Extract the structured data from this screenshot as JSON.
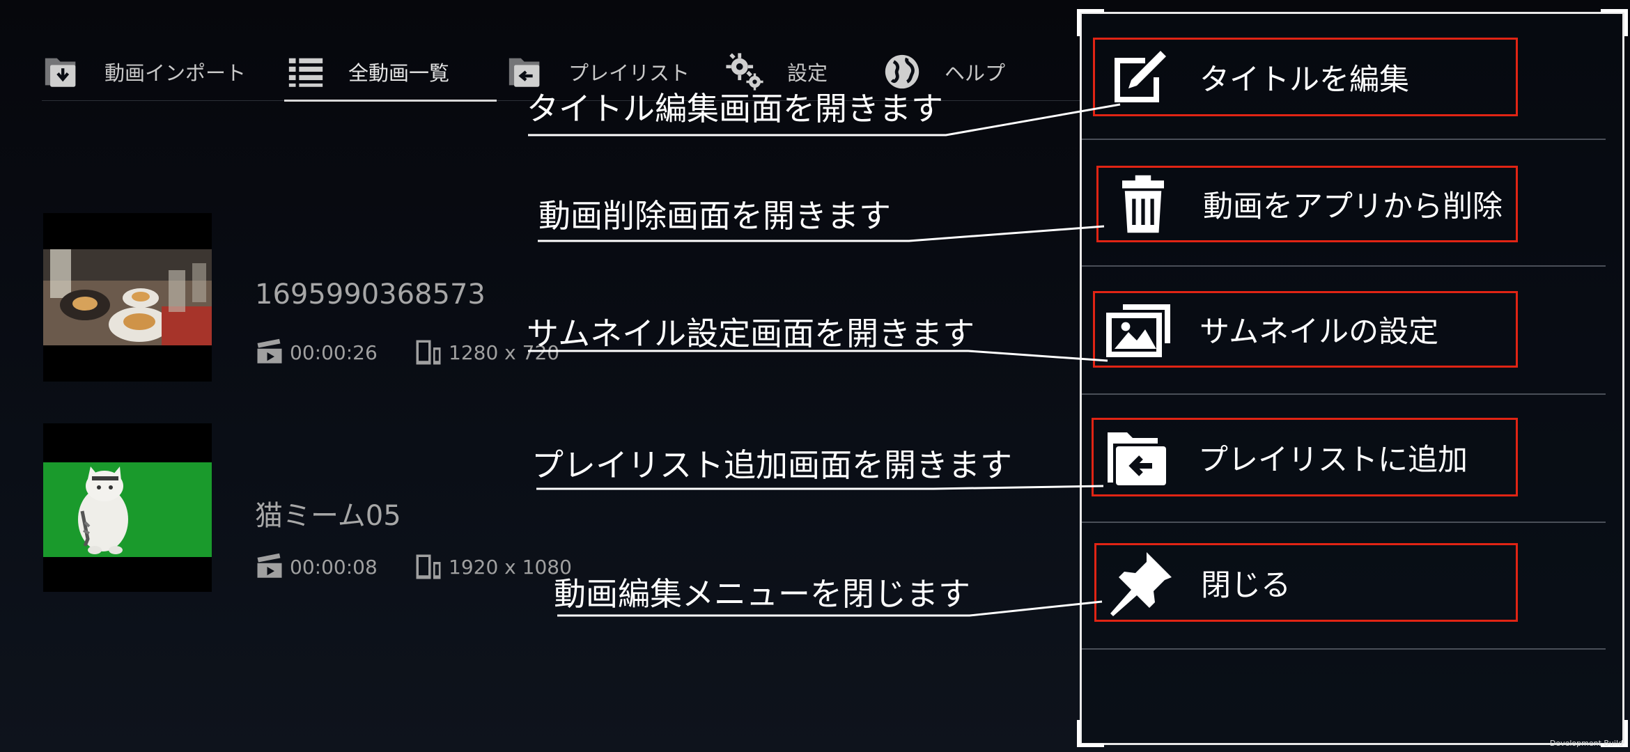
{
  "nav": {
    "items": [
      {
        "label": "動画インポート",
        "icon": "import-icon"
      },
      {
        "label": "全動画一覧",
        "icon": "list-icon"
      },
      {
        "label": "プレイリスト",
        "icon": "playlist-icon"
      },
      {
        "label": "設定",
        "icon": "gears-icon"
      },
      {
        "label": "ヘルプ",
        "icon": "globe-icon"
      }
    ],
    "active_index": 1
  },
  "videos": [
    {
      "title": "1695990368573",
      "duration": "00:00:26",
      "resolution": "1280 x 720",
      "thumbnail": "restaurant-table-photo"
    },
    {
      "title": "猫ミーム05",
      "duration": "00:00:08",
      "resolution": "1920 x 1080",
      "thumbnail": "cat-on-green-screen"
    }
  ],
  "menu": {
    "items": [
      {
        "label": "タイトルを編集",
        "icon": "edit-icon"
      },
      {
        "label": "動画をアプリから削除",
        "icon": "trash-icon"
      },
      {
        "label": "サムネイルの設定",
        "icon": "images-icon"
      },
      {
        "label": "プレイリストに追加",
        "icon": "playlist-add-icon"
      },
      {
        "label": "閉じる",
        "icon": "pin-icon"
      }
    ]
  },
  "annotations": [
    "タイトル編集画面を開きます",
    "動画削除画面を開きます",
    "サムネイル設定画面を開きます",
    "プレイリスト追加画面を開きます",
    "動画編集メニューを閉じます"
  ],
  "watermark": "Development Build",
  "colors": {
    "highlight_border": "#e02414",
    "green_screen": "#1a9a2c",
    "panel_border": "#e9e9e9"
  }
}
